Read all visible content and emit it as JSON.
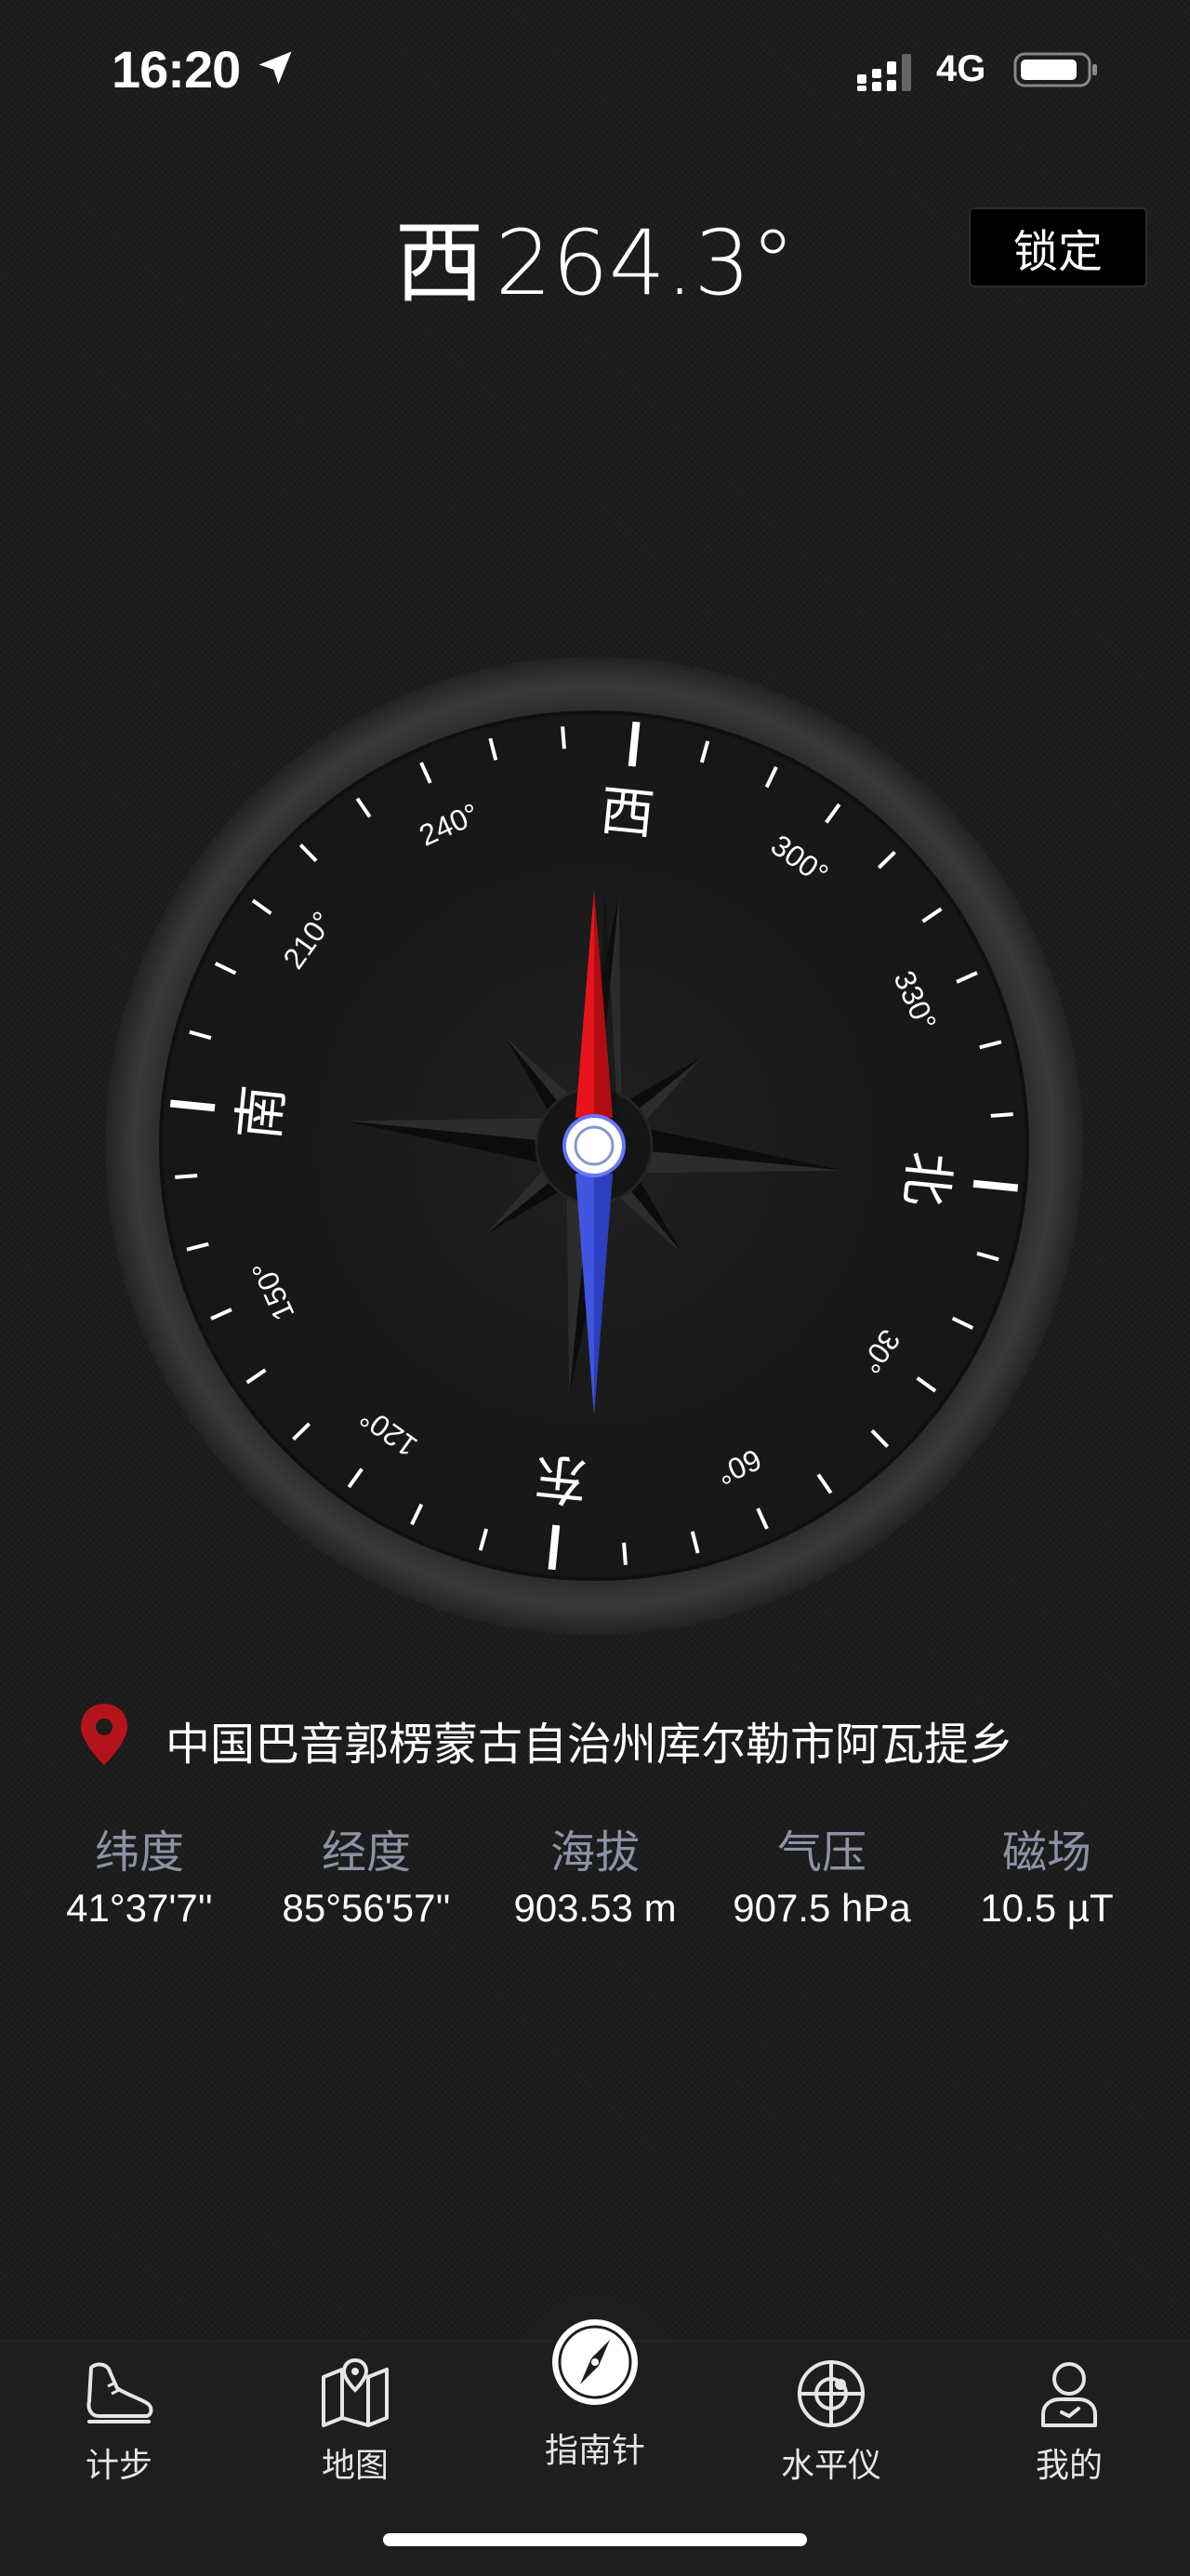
{
  "status_bar": {
    "time": "16:20",
    "network": "4G"
  },
  "header": {
    "direction": "西",
    "degrees": "264.3°",
    "lock_label": "锁定"
  },
  "compass": {
    "heading_deg": 264.3,
    "cardinals": {
      "north": "北",
      "east": "东",
      "south": "南",
      "west": "西"
    },
    "degree_labels": [
      "30°",
      "60°",
      "120°",
      "150°",
      "210°",
      "240°",
      "300°",
      "330°"
    ]
  },
  "location": {
    "address": "中国巴音郭楞蒙古自治州库尔勒市阿瓦提乡"
  },
  "stats": [
    {
      "label": "纬度",
      "value": "41°37'7''"
    },
    {
      "label": "经度",
      "value": "85°56'57''"
    },
    {
      "label": "海拔",
      "value": "903.53 m"
    },
    {
      "label": "气压",
      "value": "907.5 hPa"
    },
    {
      "label": "磁场",
      "value": "10.5 µT"
    }
  ],
  "tabs": [
    {
      "label": "计步",
      "icon": "shoe-icon"
    },
    {
      "label": "地图",
      "icon": "map-icon"
    },
    {
      "label": "指南针",
      "icon": "compass-icon",
      "active": true
    },
    {
      "label": "水平仪",
      "icon": "level-icon"
    },
    {
      "label": "我的",
      "icon": "profile-icon"
    }
  ],
  "colors": {
    "needle_north": "#e8141c",
    "needle_south": "#4055e0",
    "stat_label": "#8c93a6"
  }
}
